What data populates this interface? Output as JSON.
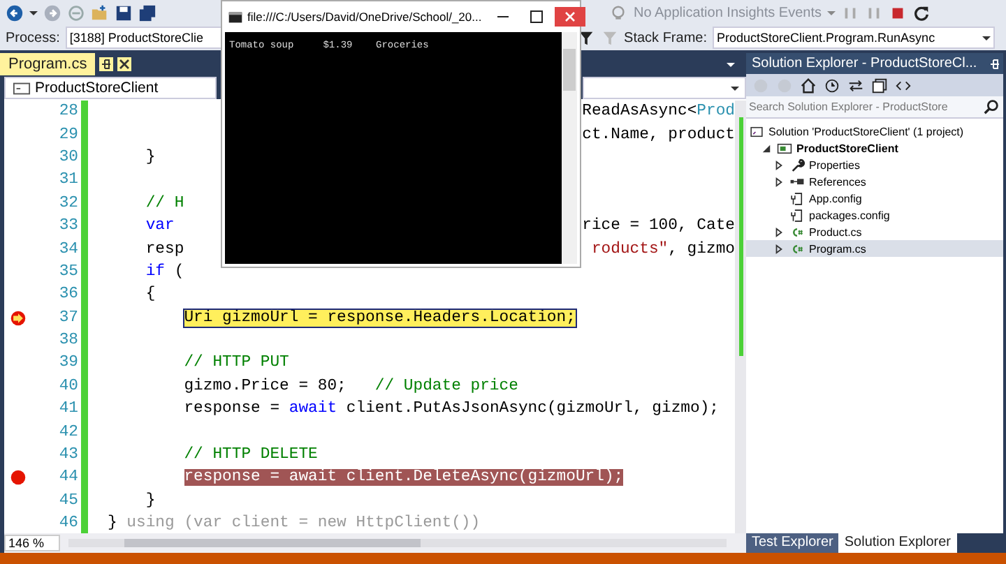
{
  "toolbar": {
    "insights": "No Application Insights Events",
    "process_label": "Process:",
    "process_value": "[3188] ProductStoreClie",
    "stack_frame_label": "Stack Frame:",
    "stack_frame_value": "ProductStoreClient.Program.RunAsync"
  },
  "editor": {
    "tabs": [
      {
        "label": "Program.cs",
        "selected": true
      }
    ],
    "navigation": "ProductStoreClient",
    "zoom": "146 %",
    "lines": [
      {
        "number": "28",
        "kind": "normal",
        "right": [
          {
            "text": "ReadAsAsync<",
            "kind": "plain"
          },
          {
            "text": "Prod",
            "kind": "type"
          }
        ]
      },
      {
        "number": "29",
        "kind": "normal",
        "right": [
          {
            "text": "ct.Name, product",
            "kind": "plain"
          }
        ]
      },
      {
        "number": "30",
        "kind": "normal",
        "left": [
          {
            "text": "    }",
            "kind": "plain"
          }
        ]
      },
      {
        "number": "31",
        "kind": "normal"
      },
      {
        "number": "32",
        "kind": "normal",
        "left": [
          {
            "text": "    // H",
            "kind": "comment"
          }
        ]
      },
      {
        "number": "33",
        "kind": "normal",
        "left": [
          {
            "text": "    var",
            "kind": "keyword"
          }
        ],
        "right": [
          {
            "text": "rice = 100, Cate",
            "kind": "plain"
          }
        ]
      },
      {
        "number": "34",
        "kind": "normal",
        "left": [
          {
            "text": "    resp",
            "kind": "plain"
          }
        ],
        "right": [
          {
            "text": "roducts\"",
            "kind": "string"
          },
          {
            "text": ", gizmo",
            "kind": "plain"
          }
        ]
      },
      {
        "number": "35",
        "kind": "normal",
        "left": [
          {
            "text": "    if",
            "kind": "keyword"
          },
          {
            "text": " (",
            "kind": "plain"
          }
        ]
      },
      {
        "number": "36",
        "kind": "normal",
        "left": [
          {
            "text": "    {",
            "kind": "plain"
          }
        ]
      },
      {
        "number": "37",
        "kind": "current",
        "left": [
          {
            "text": "        Uri gizmoUrl = response.Headers.Location;",
            "kind": "plain"
          }
        ]
      },
      {
        "number": "38",
        "kind": "normal"
      },
      {
        "number": "39",
        "kind": "normal",
        "left": [
          {
            "text": "        // HTTP PUT",
            "kind": "comment"
          }
        ]
      },
      {
        "number": "40",
        "kind": "normal",
        "left": [
          {
            "text": "        gizmo.Price = 80;   ",
            "kind": "plain"
          },
          {
            "text": "// Update price",
            "kind": "comment"
          }
        ]
      },
      {
        "number": "41",
        "kind": "normal",
        "left": [
          {
            "text": "        response = ",
            "kind": "plain"
          },
          {
            "text": "await",
            "kind": "keyword"
          },
          {
            "text": " client.PutAsJsonAsync(gizmoUrl, gizmo);",
            "kind": "plain"
          }
        ]
      },
      {
        "number": "42",
        "kind": "normal"
      },
      {
        "number": "43",
        "kind": "normal",
        "left": [
          {
            "text": "        // HTTP DELETE",
            "kind": "comment"
          }
        ]
      },
      {
        "number": "44",
        "kind": "breakpoint",
        "left": [
          {
            "text": "        response = await client.DeleteAsync(gizmoUrl);",
            "kind": "plain"
          }
        ]
      },
      {
        "number": "45",
        "kind": "normal",
        "left": [
          {
            "text": "    }",
            "kind": "plain"
          }
        ]
      },
      {
        "number": "46",
        "kind": "normal",
        "left": [
          {
            "text": "}",
            "kind": "plain"
          },
          {
            "text": " using (var client = new HttpClient())",
            "kind": "hint"
          }
        ]
      }
    ]
  },
  "console": {
    "title": "file:///C:/Users/David/OneDrive/School/_20...",
    "output": "Tomato soup     $1.39    Groceries"
  },
  "solution_explorer": {
    "title": "Solution Explorer - ProductStoreCl...",
    "search": {
      "placeholder": "Search Solution Explorer - ProductStore"
    },
    "tree": [
      {
        "label": "Solution 'ProductStoreClient' (1 project)",
        "kind": "solution",
        "selected": false,
        "children": [
          {
            "label": "ProductStoreClient",
            "kind": "project",
            "expanded": true,
            "selected": false,
            "children": [
              {
                "label": "Properties",
                "kind": "properties",
                "expanded": false,
                "selected": false
              },
              {
                "label": "References",
                "kind": "references",
                "expanded": false,
                "selected": false
              },
              {
                "label": "App.config",
                "kind": "config",
                "selected": false
              },
              {
                "label": "packages.config",
                "kind": "config",
                "selected": false
              },
              {
                "label": "Product.cs",
                "kind": "csharp",
                "expanded": false,
                "selected": false
              },
              {
                "label": "Program.cs",
                "kind": "csharp",
                "expanded": false,
                "selected": true
              }
            ]
          }
        ]
      }
    ]
  },
  "bottom_tabs": [
    {
      "label": "Test Explorer",
      "selected": false
    },
    {
      "label": "Solution Explorer",
      "selected": true
    }
  ]
}
